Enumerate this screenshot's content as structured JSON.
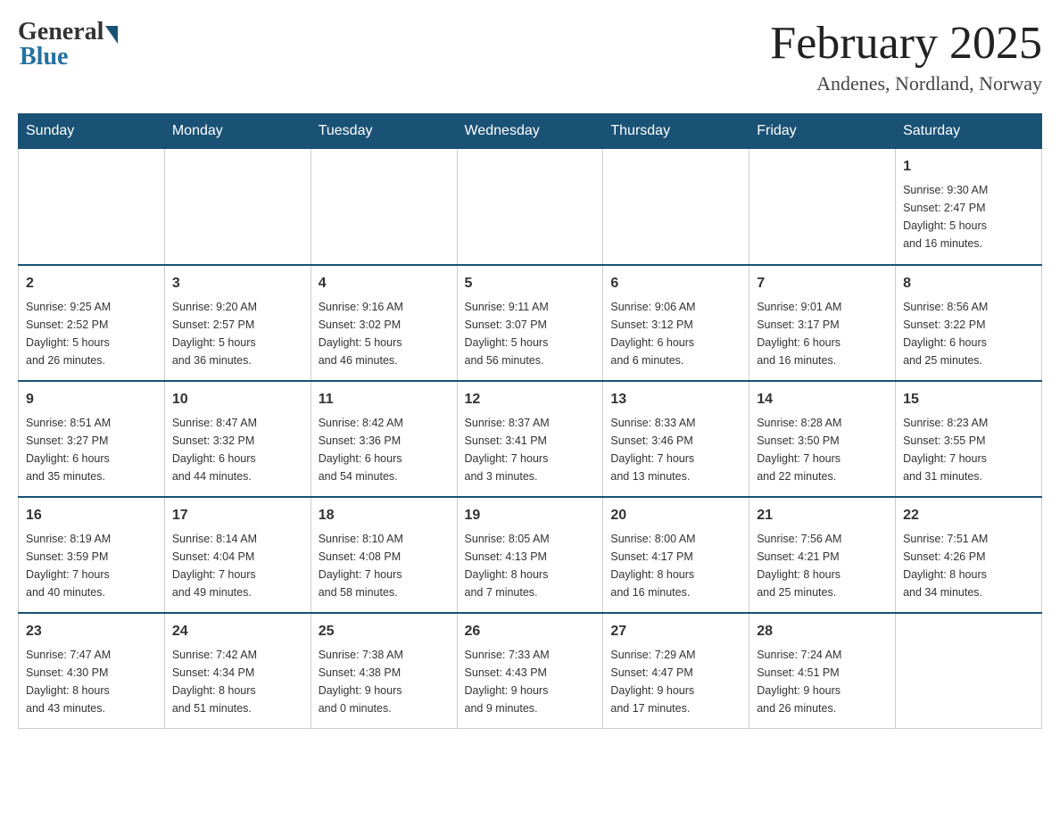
{
  "header": {
    "logo_general": "General",
    "logo_blue": "Blue",
    "month_title": "February 2025",
    "location": "Andenes, Nordland, Norway"
  },
  "days_of_week": [
    "Sunday",
    "Monday",
    "Tuesday",
    "Wednesday",
    "Thursday",
    "Friday",
    "Saturday"
  ],
  "weeks": [
    [
      {
        "day": "",
        "info": ""
      },
      {
        "day": "",
        "info": ""
      },
      {
        "day": "",
        "info": ""
      },
      {
        "day": "",
        "info": ""
      },
      {
        "day": "",
        "info": ""
      },
      {
        "day": "",
        "info": ""
      },
      {
        "day": "1",
        "info": "Sunrise: 9:30 AM\nSunset: 2:47 PM\nDaylight: 5 hours\nand 16 minutes."
      }
    ],
    [
      {
        "day": "2",
        "info": "Sunrise: 9:25 AM\nSunset: 2:52 PM\nDaylight: 5 hours\nand 26 minutes."
      },
      {
        "day": "3",
        "info": "Sunrise: 9:20 AM\nSunset: 2:57 PM\nDaylight: 5 hours\nand 36 minutes."
      },
      {
        "day": "4",
        "info": "Sunrise: 9:16 AM\nSunset: 3:02 PM\nDaylight: 5 hours\nand 46 minutes."
      },
      {
        "day": "5",
        "info": "Sunrise: 9:11 AM\nSunset: 3:07 PM\nDaylight: 5 hours\nand 56 minutes."
      },
      {
        "day": "6",
        "info": "Sunrise: 9:06 AM\nSunset: 3:12 PM\nDaylight: 6 hours\nand 6 minutes."
      },
      {
        "day": "7",
        "info": "Sunrise: 9:01 AM\nSunset: 3:17 PM\nDaylight: 6 hours\nand 16 minutes."
      },
      {
        "day": "8",
        "info": "Sunrise: 8:56 AM\nSunset: 3:22 PM\nDaylight: 6 hours\nand 25 minutes."
      }
    ],
    [
      {
        "day": "9",
        "info": "Sunrise: 8:51 AM\nSunset: 3:27 PM\nDaylight: 6 hours\nand 35 minutes."
      },
      {
        "day": "10",
        "info": "Sunrise: 8:47 AM\nSunset: 3:32 PM\nDaylight: 6 hours\nand 44 minutes."
      },
      {
        "day": "11",
        "info": "Sunrise: 8:42 AM\nSunset: 3:36 PM\nDaylight: 6 hours\nand 54 minutes."
      },
      {
        "day": "12",
        "info": "Sunrise: 8:37 AM\nSunset: 3:41 PM\nDaylight: 7 hours\nand 3 minutes."
      },
      {
        "day": "13",
        "info": "Sunrise: 8:33 AM\nSunset: 3:46 PM\nDaylight: 7 hours\nand 13 minutes."
      },
      {
        "day": "14",
        "info": "Sunrise: 8:28 AM\nSunset: 3:50 PM\nDaylight: 7 hours\nand 22 minutes."
      },
      {
        "day": "15",
        "info": "Sunrise: 8:23 AM\nSunset: 3:55 PM\nDaylight: 7 hours\nand 31 minutes."
      }
    ],
    [
      {
        "day": "16",
        "info": "Sunrise: 8:19 AM\nSunset: 3:59 PM\nDaylight: 7 hours\nand 40 minutes."
      },
      {
        "day": "17",
        "info": "Sunrise: 8:14 AM\nSunset: 4:04 PM\nDaylight: 7 hours\nand 49 minutes."
      },
      {
        "day": "18",
        "info": "Sunrise: 8:10 AM\nSunset: 4:08 PM\nDaylight: 7 hours\nand 58 minutes."
      },
      {
        "day": "19",
        "info": "Sunrise: 8:05 AM\nSunset: 4:13 PM\nDaylight: 8 hours\nand 7 minutes."
      },
      {
        "day": "20",
        "info": "Sunrise: 8:00 AM\nSunset: 4:17 PM\nDaylight: 8 hours\nand 16 minutes."
      },
      {
        "day": "21",
        "info": "Sunrise: 7:56 AM\nSunset: 4:21 PM\nDaylight: 8 hours\nand 25 minutes."
      },
      {
        "day": "22",
        "info": "Sunrise: 7:51 AM\nSunset: 4:26 PM\nDaylight: 8 hours\nand 34 minutes."
      }
    ],
    [
      {
        "day": "23",
        "info": "Sunrise: 7:47 AM\nSunset: 4:30 PM\nDaylight: 8 hours\nand 43 minutes."
      },
      {
        "day": "24",
        "info": "Sunrise: 7:42 AM\nSunset: 4:34 PM\nDaylight: 8 hours\nand 51 minutes."
      },
      {
        "day": "25",
        "info": "Sunrise: 7:38 AM\nSunset: 4:38 PM\nDaylight: 9 hours\nand 0 minutes."
      },
      {
        "day": "26",
        "info": "Sunrise: 7:33 AM\nSunset: 4:43 PM\nDaylight: 9 hours\nand 9 minutes."
      },
      {
        "day": "27",
        "info": "Sunrise: 7:29 AM\nSunset: 4:47 PM\nDaylight: 9 hours\nand 17 minutes."
      },
      {
        "day": "28",
        "info": "Sunrise: 7:24 AM\nSunset: 4:51 PM\nDaylight: 9 hours\nand 26 minutes."
      },
      {
        "day": "",
        "info": ""
      }
    ]
  ]
}
